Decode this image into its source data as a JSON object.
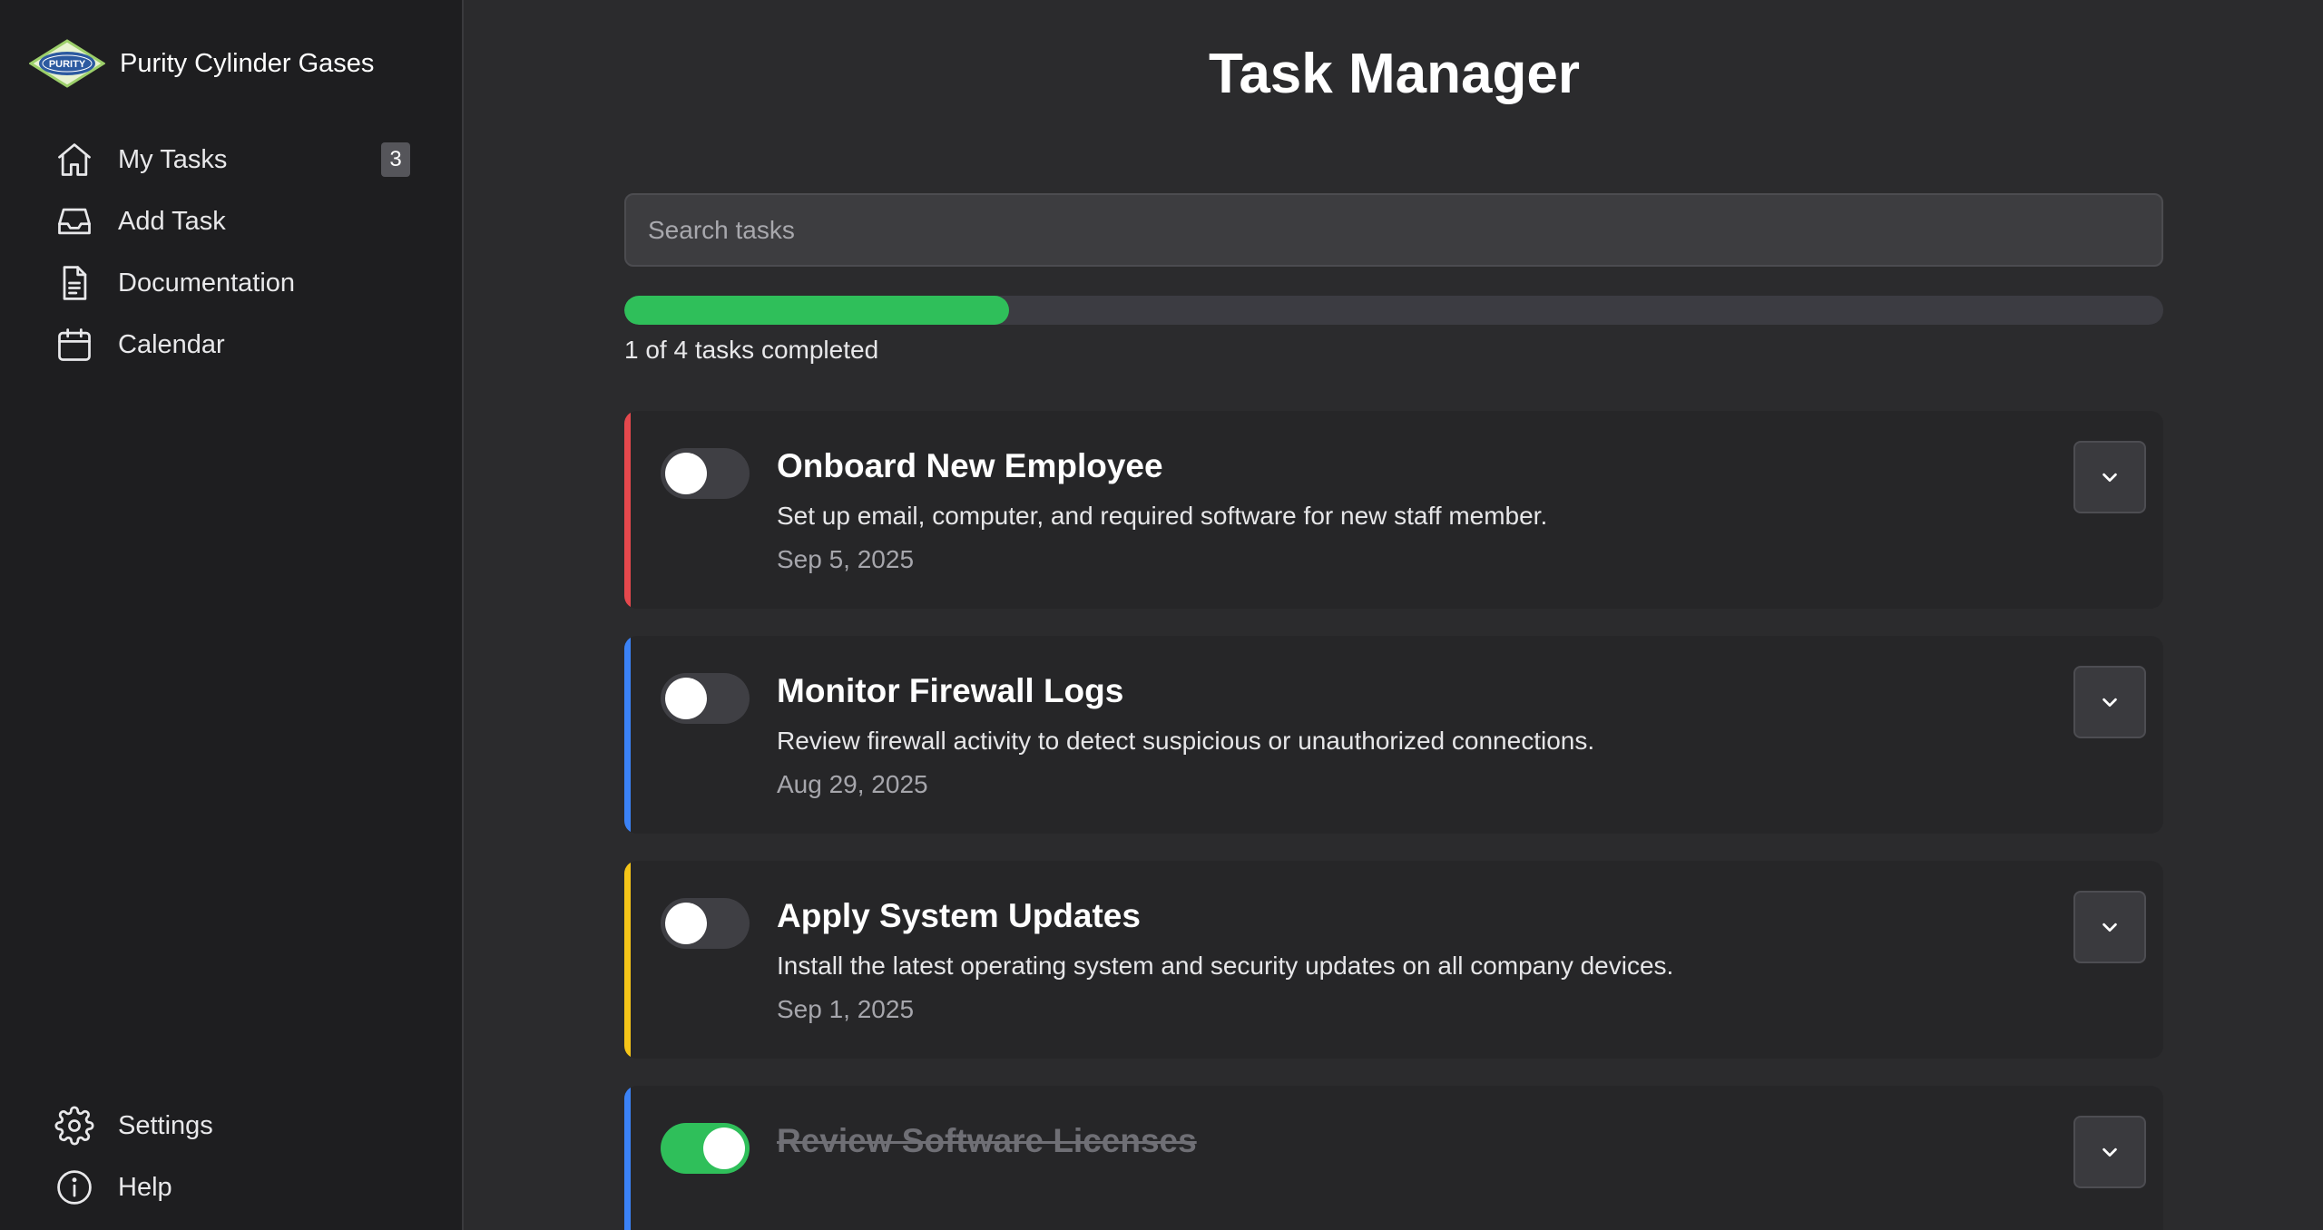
{
  "sidebar": {
    "brand": {
      "name": "Purity Cylinder Gases",
      "logo_text": "PURITY"
    },
    "nav": [
      {
        "label": "My Tasks",
        "icon": "home-icon",
        "badge": "3"
      },
      {
        "label": "Add Task",
        "icon": "inbox-icon"
      },
      {
        "label": "Documentation",
        "icon": "document-icon"
      },
      {
        "label": "Calendar",
        "icon": "calendar-icon"
      }
    ],
    "footer": [
      {
        "label": "Settings",
        "icon": "gear-icon"
      },
      {
        "label": "Help",
        "icon": "info-icon"
      }
    ]
  },
  "main": {
    "title": "Task Manager",
    "search": {
      "placeholder": "Search tasks",
      "value": ""
    },
    "progress": {
      "completed": 1,
      "total": 4,
      "fraction": 0.25,
      "text": "1 of 4 tasks completed"
    },
    "tasks": [
      {
        "title": "Onboard New Employee",
        "description": "Set up email, computer, and required software for new staff member.",
        "date": "Sep 5, 2025",
        "completed": false,
        "priority_color": "#e5484d"
      },
      {
        "title": "Monitor Firewall Logs",
        "description": "Review firewall activity to detect suspicious or unauthorized connections.",
        "date": "Aug 29, 2025",
        "completed": false,
        "priority_color": "#3b82f6"
      },
      {
        "title": "Apply System Updates",
        "description": "Install the latest operating system and security updates on all company devices.",
        "date": "Sep 1, 2025",
        "completed": false,
        "priority_color": "#f5c518"
      },
      {
        "title": "Review Software Licenses",
        "completed": true,
        "priority_color": "#3b82f6"
      }
    ]
  },
  "colors": {
    "accent_green": "#2fbf5a",
    "sidebar_bg": "#1e1e20",
    "main_bg": "#2b2b2d",
    "card_bg": "#262628"
  }
}
